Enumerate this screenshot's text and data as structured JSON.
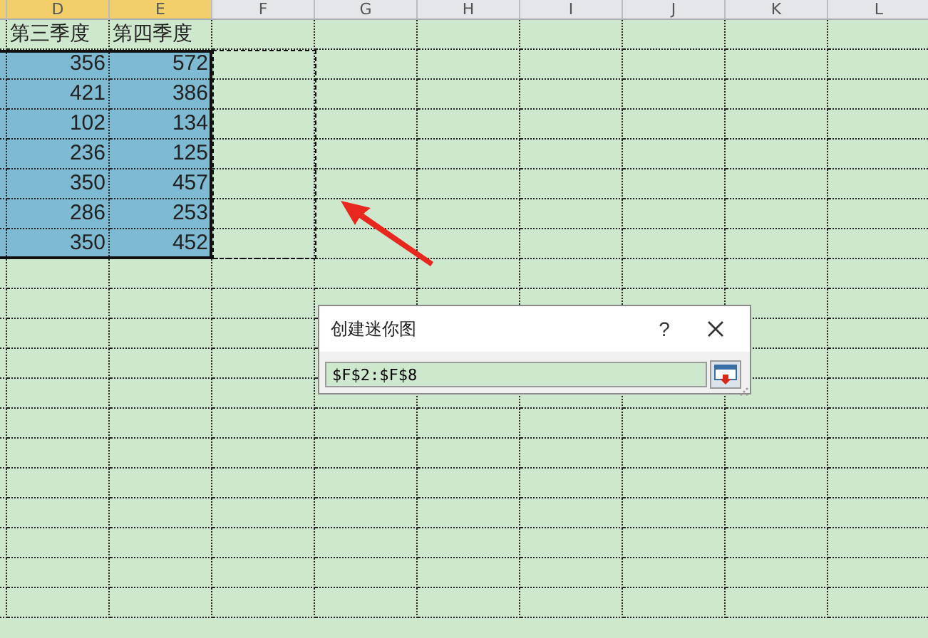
{
  "column_headers": [
    {
      "label": "D",
      "selected": true
    },
    {
      "label": "E",
      "selected": true
    },
    {
      "label": "F",
      "selected": false
    },
    {
      "label": "G",
      "selected": false
    },
    {
      "label": "H",
      "selected": false
    },
    {
      "label": "I",
      "selected": false
    },
    {
      "label": "J",
      "selected": false
    },
    {
      "label": "K",
      "selected": false
    },
    {
      "label": "L",
      "selected": false
    }
  ],
  "rows": [
    {
      "cells": [
        "第三季度",
        "第四季度"
      ],
      "selected": false
    },
    {
      "cells": [
        "356",
        "572"
      ],
      "selected": true
    },
    {
      "cells": [
        "421",
        "386"
      ],
      "selected": true
    },
    {
      "cells": [
        "102",
        "134"
      ],
      "selected": true
    },
    {
      "cells": [
        "236",
        "125"
      ],
      "selected": true
    },
    {
      "cells": [
        "350",
        "457"
      ],
      "selected": true
    },
    {
      "cells": [
        "286",
        "253"
      ],
      "selected": true
    },
    {
      "cells": [
        "350",
        "452"
      ],
      "selected": true
    }
  ],
  "dialog": {
    "title": "创建迷你图",
    "help": "?",
    "value": "$F$2:$F$8"
  }
}
